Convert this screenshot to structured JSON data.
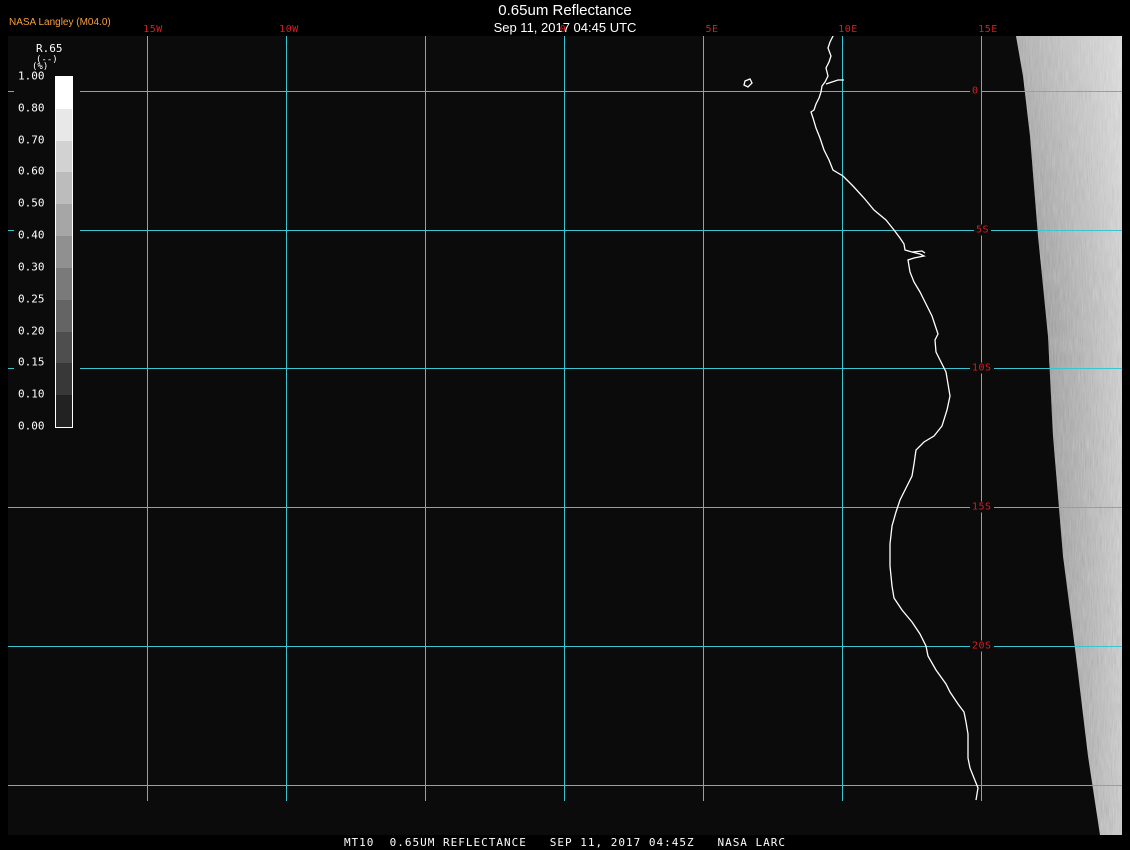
{
  "header": {
    "title": "0.65um Reflectance",
    "timestamp": "Sep 11, 2017 04:45 UTC",
    "provider": "NASA Langley (M04.0)"
  },
  "map": {
    "longitude_labels": [
      "15W",
      "10W",
      "0",
      "5E",
      "10E",
      "15E"
    ],
    "latitude_labels": [
      "0",
      "5S",
      "10S",
      "15S",
      "20S"
    ],
    "colors": {
      "gridline": "#39c6cf",
      "grid_label": "#d51f1f",
      "coastline": "#ffffff",
      "background": "#0b0b0b"
    }
  },
  "legend": {
    "title": "R.65",
    "units": "(--)",
    "unit_symbol": "(%)",
    "ticks": [
      "1.00",
      "0.80",
      "0.70",
      "0.60",
      "0.50",
      "0.40",
      "0.30",
      "0.25",
      "0.20",
      "0.15",
      "0.10",
      "0.00"
    ],
    "colors": [
      "#ffffff",
      "#e8e8e8",
      "#d2d2d2",
      "#bcbcbc",
      "#a6a6a6",
      "#909090",
      "#7a7a7a",
      "#646464",
      "#4e4e4e",
      "#383838",
      "#222222"
    ]
  },
  "footer": {
    "caption": "MT10  0.65UM REFLECTANCE   SEP 11, 2017 04:45Z   NASA LARC"
  }
}
